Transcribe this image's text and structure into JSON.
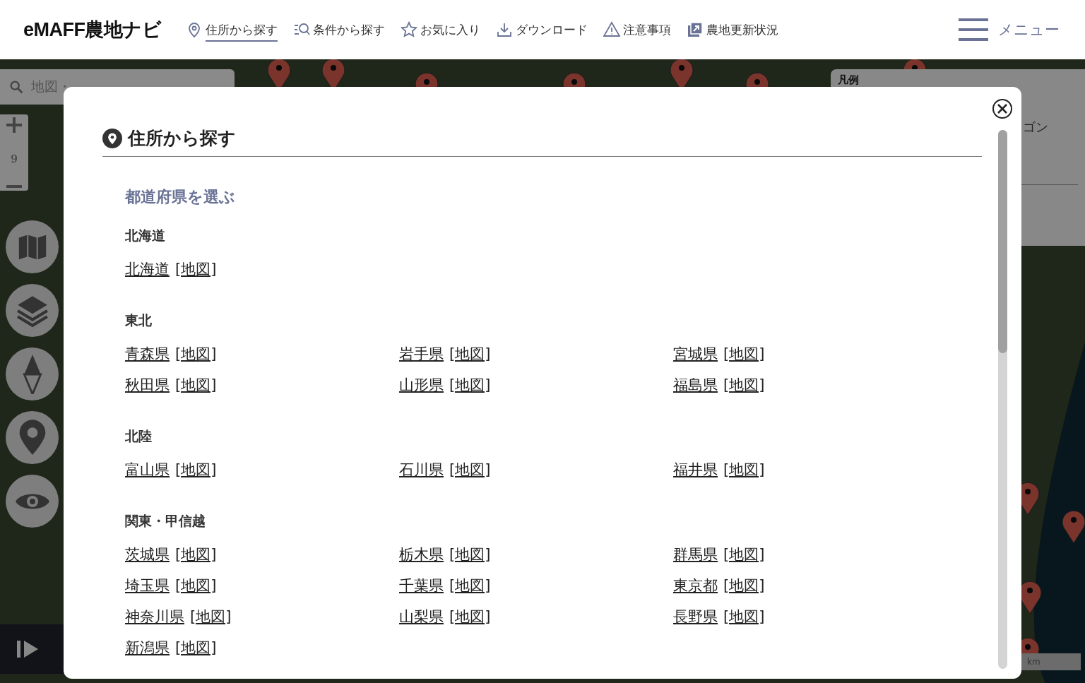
{
  "header": {
    "logo": "eMAFF農地ナビ",
    "nav": [
      {
        "label": "住所から探す",
        "selected": true
      },
      {
        "label": "条件から探す",
        "selected": false
      },
      {
        "label": "お気に入り",
        "selected": false
      },
      {
        "label": "ダウンロード",
        "selected": false
      },
      {
        "label": "注意事項",
        "selected": false
      },
      {
        "label": "農地更新状況",
        "selected": false
      }
    ],
    "menu_label": "メニュー"
  },
  "map": {
    "search_placeholder": "地図・",
    "zoom_level": "9",
    "legend_title": "凡例",
    "legend_text": "ゴン",
    "scale_unit": "km"
  },
  "dialog": {
    "title": "住所から探す",
    "section_title": "都道府県を選ぶ",
    "regions": [
      {
        "name": "北海道",
        "prefectures": [
          {
            "name": "北海道",
            "map_link": "[地図]"
          }
        ]
      },
      {
        "name": "東北",
        "prefectures": [
          {
            "name": "青森県",
            "map_link": "[地図]"
          },
          {
            "name": "岩手県",
            "map_link": "[地図]"
          },
          {
            "name": "宮城県",
            "map_link": "[地図]"
          },
          {
            "name": "秋田県",
            "map_link": "[地図]"
          },
          {
            "name": "山形県",
            "map_link": "[地図]"
          },
          {
            "name": "福島県",
            "map_link": "[地図]"
          }
        ]
      },
      {
        "name": "北陸",
        "prefectures": [
          {
            "name": "富山県",
            "map_link": "[地図]"
          },
          {
            "name": "石川県",
            "map_link": "[地図]"
          },
          {
            "name": "福井県",
            "map_link": "[地図]"
          }
        ]
      },
      {
        "name": "関東・甲信越",
        "prefectures": [
          {
            "name": "茨城県",
            "map_link": "[地図]"
          },
          {
            "name": "栃木県",
            "map_link": "[地図]"
          },
          {
            "name": "群馬県",
            "map_link": "[地図]"
          },
          {
            "name": "埼玉県",
            "map_link": "[地図]"
          },
          {
            "name": "千葉県",
            "map_link": "[地図]"
          },
          {
            "name": "東京都",
            "map_link": "[地図]"
          },
          {
            "name": "神奈川県",
            "map_link": "[地図]"
          },
          {
            "name": "山梨県",
            "map_link": "[地図]"
          },
          {
            "name": "長野県",
            "map_link": "[地図]"
          },
          {
            "name": "新潟県",
            "map_link": "[地図]"
          }
        ]
      }
    ]
  }
}
